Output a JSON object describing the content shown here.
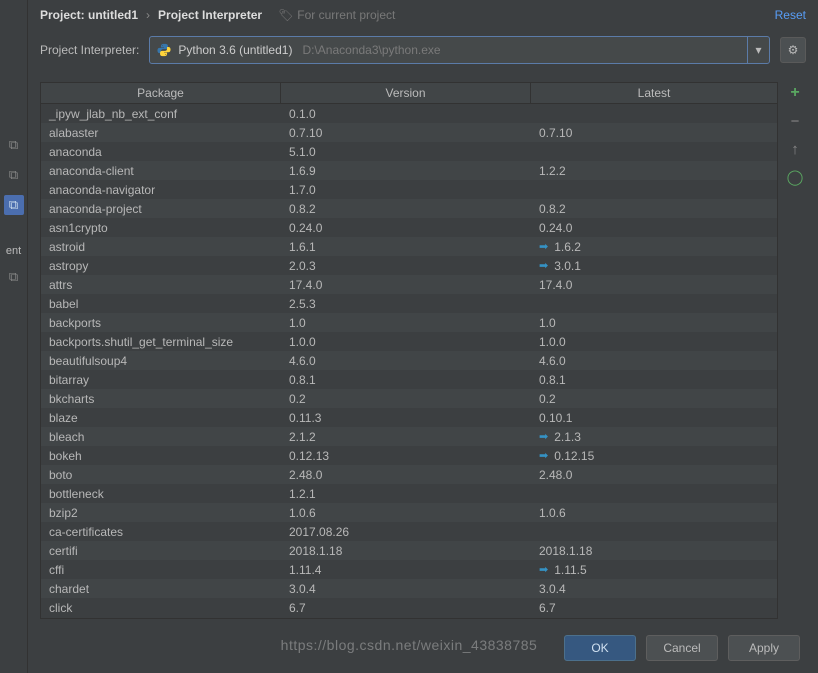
{
  "breadcrumb": {
    "project": "Project: untitled1",
    "page": "Project Interpreter",
    "hint": "For current project",
    "reset": "Reset"
  },
  "interpreter": {
    "label": "Project Interpreter:",
    "selected_name": "Python 3.6 (untitled1)",
    "selected_path": "D:\\Anaconda3\\python.exe"
  },
  "table": {
    "headers": {
      "package": "Package",
      "version": "Version",
      "latest": "Latest"
    },
    "rows": [
      {
        "pkg": "_ipyw_jlab_nb_ext_conf",
        "ver": "0.1.0",
        "lat": "",
        "upd": false
      },
      {
        "pkg": "alabaster",
        "ver": "0.7.10",
        "lat": "0.7.10",
        "upd": false
      },
      {
        "pkg": "anaconda",
        "ver": "5.1.0",
        "lat": "",
        "upd": false
      },
      {
        "pkg": "anaconda-client",
        "ver": "1.6.9",
        "lat": "1.2.2",
        "upd": false
      },
      {
        "pkg": "anaconda-navigator",
        "ver": "1.7.0",
        "lat": "",
        "upd": false
      },
      {
        "pkg": "anaconda-project",
        "ver": "0.8.2",
        "lat": "0.8.2",
        "upd": false
      },
      {
        "pkg": "asn1crypto",
        "ver": "0.24.0",
        "lat": "0.24.0",
        "upd": false
      },
      {
        "pkg": "astroid",
        "ver": "1.6.1",
        "lat": "1.6.2",
        "upd": true
      },
      {
        "pkg": "astropy",
        "ver": "2.0.3",
        "lat": "3.0.1",
        "upd": true
      },
      {
        "pkg": "attrs",
        "ver": "17.4.0",
        "lat": "17.4.0",
        "upd": false
      },
      {
        "pkg": "babel",
        "ver": "2.5.3",
        "lat": "",
        "upd": false
      },
      {
        "pkg": "backports",
        "ver": "1.0",
        "lat": "1.0",
        "upd": false
      },
      {
        "pkg": "backports.shutil_get_terminal_size",
        "ver": "1.0.0",
        "lat": "1.0.0",
        "upd": false
      },
      {
        "pkg": "beautifulsoup4",
        "ver": "4.6.0",
        "lat": "4.6.0",
        "upd": false
      },
      {
        "pkg": "bitarray",
        "ver": "0.8.1",
        "lat": "0.8.1",
        "upd": false
      },
      {
        "pkg": "bkcharts",
        "ver": "0.2",
        "lat": "0.2",
        "upd": false
      },
      {
        "pkg": "blaze",
        "ver": "0.11.3",
        "lat": "0.10.1",
        "upd": false
      },
      {
        "pkg": "bleach",
        "ver": "2.1.2",
        "lat": "2.1.3",
        "upd": true
      },
      {
        "pkg": "bokeh",
        "ver": "0.12.13",
        "lat": "0.12.15",
        "upd": true
      },
      {
        "pkg": "boto",
        "ver": "2.48.0",
        "lat": "2.48.0",
        "upd": false
      },
      {
        "pkg": "bottleneck",
        "ver": "1.2.1",
        "lat": "",
        "upd": false
      },
      {
        "pkg": "bzip2",
        "ver": "1.0.6",
        "lat": "1.0.6",
        "upd": false
      },
      {
        "pkg": "ca-certificates",
        "ver": "2017.08.26",
        "lat": "",
        "upd": false
      },
      {
        "pkg": "certifi",
        "ver": "2018.1.18",
        "lat": "2018.1.18",
        "upd": false
      },
      {
        "pkg": "cffi",
        "ver": "1.11.4",
        "lat": "1.11.5",
        "upd": true
      },
      {
        "pkg": "chardet",
        "ver": "3.0.4",
        "lat": "3.0.4",
        "upd": false
      },
      {
        "pkg": "click",
        "ver": "6.7",
        "lat": "6.7",
        "upd": false
      }
    ]
  },
  "footer": {
    "ok": "OK",
    "cancel": "Cancel",
    "apply": "Apply"
  },
  "watermark": "https://blog.csdn.net/weixin_43838785",
  "leftRail": {
    "ent": "ent"
  }
}
